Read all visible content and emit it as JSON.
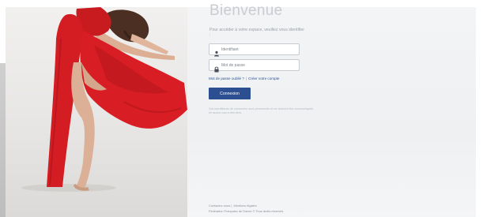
{
  "login": {
    "title": "Bienvenue",
    "intro": "Pour accéder à votre espace, veuillez vous identifier :",
    "username_placeholder": "Identifiant",
    "password_placeholder": "Mot de passe",
    "forgot_password_link": "Mot de passe oublié ?",
    "separator": "|",
    "create_account_link": "Créer votre compte",
    "submit_label": "Connexion",
    "notice": "Vos identifiants de connexion sont personnels et ne doivent être communiqués en aucun cas à des tiers."
  },
  "footer": {
    "contact_link": "Contactez-nous",
    "separator": "|",
    "legal_link": "Mentions légales",
    "copyright": "Fédération Française de Danse © Tous droits réservés"
  },
  "colors": {
    "accent": "#2c4f92",
    "link": "#2b5597",
    "dress": "#d81e24"
  },
  "icons": {
    "username": "user-icon",
    "password": "lock-icon"
  }
}
